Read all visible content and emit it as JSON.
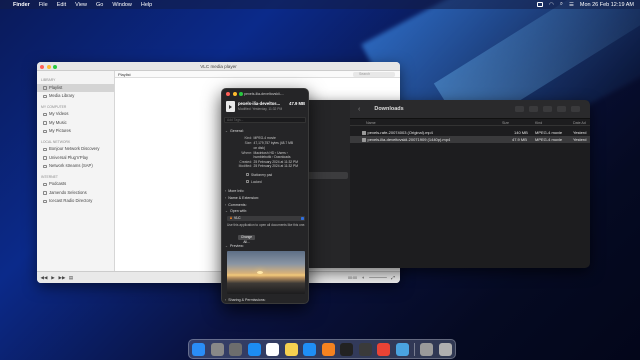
{
  "menubar": {
    "app": "Finder",
    "items": [
      "File",
      "Edit",
      "View",
      "Go",
      "Window",
      "Help"
    ],
    "clock": "Mon 26 Feb 12:19 AM"
  },
  "vlc": {
    "title": "VLC media player",
    "sidebar": {
      "library_header": "LIBRARY",
      "library": [
        "Playlist",
        "Media Library"
      ],
      "mycomputer_header": "MY COMPUTER",
      "mycomputer": [
        "My Videos",
        "My Music",
        "My Pictures"
      ],
      "localnet_header": "LOCAL NETWORK",
      "localnet": [
        "Bonjour Network Discovery",
        "Universal Plug'n'Play",
        "Network streams (SAP)"
      ],
      "internet_header": "INTERNET",
      "internet": [
        "Podcasts",
        "Jamendo Selections",
        "Icecast Radio Directory"
      ]
    },
    "playlist_label": "Playlist",
    "search_placeholder": "Search",
    "time": "00:00"
  },
  "finder": {
    "title": "Downloads",
    "columns": {
      "name": "Name",
      "size": "Size",
      "kind": "Kind",
      "date": "Date Ad"
    },
    "files": [
      {
        "name": "pexels-rafe-20074003 (Original).mp4",
        "size": "140 MB",
        "kind": "MPEG-4 movie",
        "date": "Yesterd"
      },
      {
        "name": "pexels-ilia-develtovskii-20071909 (1440p).mp4",
        "size": "47.9 MB",
        "kind": "MPEG-4 movie",
        "date": "Yesterd"
      }
    ]
  },
  "info": {
    "window_title": "pexels-ilia-develtovskii-...",
    "name": "pexels-ilia-develtos...",
    "size": "47.9 MB",
    "modified_short": "Modified: Yesterday, 11:32 PM",
    "tags_placeholder": "Add Tags...",
    "general_label": "General:",
    "kind_k": "Kind:",
    "kind_v": "MPEG-4 movie",
    "size_k": "Size:",
    "size_v1": "47,179,757 bytes (48.7 MB",
    "size_v2": "on disk)",
    "where_k": "Where:",
    "where_v1": "Macintosh HD › Users ›",
    "where_v2": "humblebotik › Downloads",
    "created_k": "Created:",
    "created_v": "25 February 2024 at 11:32 PM",
    "modified_k": "Modified:",
    "modified_v": "25 February 2024 at 11:32 PM",
    "stationery": "Stationery pad",
    "locked": "Locked",
    "more_info": "More Info:",
    "name_ext": "Name & Extension:",
    "comments": "Comments:",
    "open_with": "Open with:",
    "app": "VLC",
    "use_text": "Use this application to open all documents like this one.",
    "change_all": "Change All...",
    "preview": "Preview:",
    "sharing": "Sharing & Permissions:"
  },
  "dock": {
    "apps": [
      "finder-icon",
      "launchpad-icon",
      "settings-icon",
      "safari-icon",
      "calendar-icon",
      "notes-icon",
      "appstore-icon",
      "vlc-icon",
      "terminal-icon",
      "quicktime-icon",
      "chrome-icon",
      "preview-icon",
      "photos-icon",
      "trash-icon"
    ],
    "colors": [
      "#2a8df7",
      "#888888",
      "#6d6d6d",
      "#1c8cf2",
      "#ffffff",
      "#f5d050",
      "#1f8ef5",
      "#f58220",
      "#222222",
      "#3a3a3a",
      "#e94335",
      "#4aa3e0",
      "#9a9a9a",
      "#b0b0b0"
    ]
  }
}
